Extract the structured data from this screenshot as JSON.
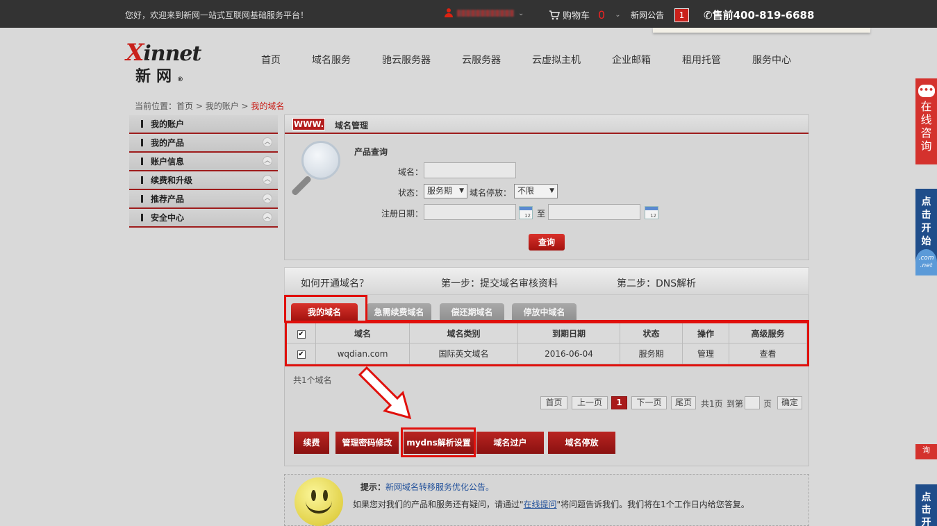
{
  "topbar": {
    "welcome": "您好，欢迎来到新网一站式互联网基础服务平台！",
    "cart_label": "购物车",
    "cart_count": "0",
    "notice_label": "新网公告",
    "notice_count": "1",
    "hotline": "售前400-819-6688"
  },
  "logo": {
    "en_x": "X",
    "en_rest": "innet",
    "cn": "新网",
    "reg": "®"
  },
  "nav": [
    "首页",
    "域名服务",
    "驰云服务器",
    "云服务器",
    "云虚拟主机",
    "企业邮箱",
    "租用托管",
    "服务中心"
  ],
  "breadcrumb": {
    "prefix": "当前位置：",
    "home": "首页",
    "sep": " > ",
    "account": "我的账户",
    "current": "我的域名"
  },
  "sidebar": [
    "我的账户",
    "我的产品",
    "账户信息",
    "续费和升级",
    "推荐产品",
    "安全中心"
  ],
  "panel": {
    "badge": "WWW.",
    "title": "域名管理"
  },
  "form": {
    "title": "产品查询",
    "domain_label": "域名：",
    "status_label": "状态：",
    "status_value": "服务期",
    "parking_label": "域名停放：",
    "parking_value": "不限",
    "date_label": "注册日期：",
    "to": "至",
    "query_btn": "查询"
  },
  "howto": {
    "q": "如何开通域名？",
    "step1": "第一步：提交域名审核资料",
    "step2": "第二步：DNS解析"
  },
  "tabs": [
    "我的域名",
    "急需续费域名",
    "偿还期域名",
    "停放中域名"
  ],
  "table": {
    "headers": [
      "域名",
      "域名类别",
      "到期日期",
      "状态",
      "操作",
      "高级服务"
    ],
    "rows": [
      {
        "domain": "wqdian.com",
        "type": "国际英文域名",
        "expiry": "2016-06-04",
        "status": "服务期",
        "action": "管理",
        "advanced": "查看"
      }
    ]
  },
  "total": "共1个域名",
  "pager": {
    "first": "首页",
    "prev": "上一页",
    "current": "1",
    "next": "下一页",
    "last": "尾页",
    "pages": "共1页",
    "goto": "到第",
    "page": "页",
    "confirm": "确定"
  },
  "actions": [
    "续费",
    "管理密码修改",
    "mydns解析设置",
    "域名过户",
    "域名停放"
  ],
  "tip": {
    "label": "提示：",
    "link": "新网域名转移服务优化公告。",
    "text_before": "如果您对我们的产品和服务还有疑问，请通过\"",
    "text_link": "在线提问",
    "text_after": "\"将问题告诉我们。我们将在1个工作日内给您答复。"
  },
  "float": {
    "chat": "在线咨询",
    "dot": "点击开始",
    "com": ".com",
    "net": ".net",
    "mini": "询",
    "dot2": "点击开"
  },
  "colors": {
    "brand_red": "#c9211b",
    "dark_bar": "#333333",
    "highlight_red": "#e0100c",
    "float_blue": "#1f4d8a"
  }
}
